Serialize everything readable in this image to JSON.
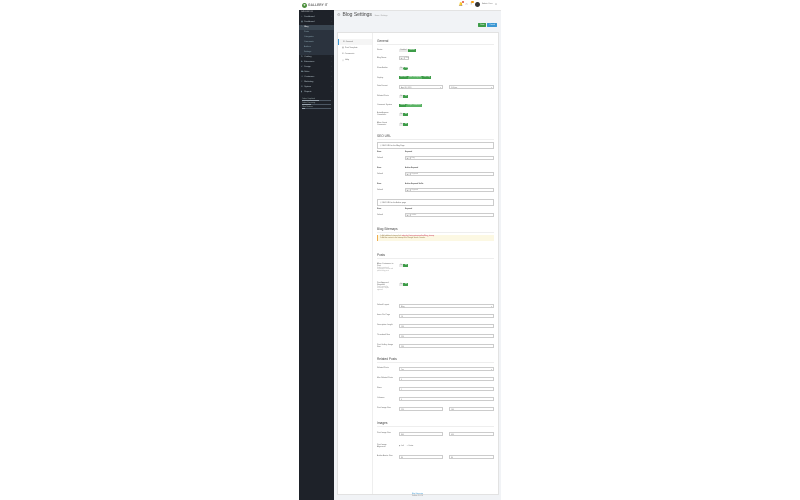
{
  "topbar": {
    "logo_text": "GALLERY IT",
    "badge_a": "1",
    "badge_b": "3",
    "user_name": "Admin User"
  },
  "sidebar": {
    "header": "NAVIGATION",
    "items": [
      {
        "label": "Dashboard",
        "icon": "home-icon"
      },
      {
        "label": "Dashboard",
        "icon": "grid-icon"
      },
      {
        "label": "Blog",
        "icon": "blog-icon",
        "active": true
      },
      {
        "label": "Catalog",
        "icon": "tag-icon"
      },
      {
        "label": "Extensions",
        "icon": "puzzle-icon"
      },
      {
        "label": "Design",
        "icon": "brush-icon"
      },
      {
        "label": "Sales",
        "icon": "cart-icon"
      },
      {
        "label": "Customers",
        "icon": "user-icon"
      },
      {
        "label": "Marketing",
        "icon": "share-icon"
      },
      {
        "label": "System",
        "icon": "gear-icon"
      },
      {
        "label": "Reports",
        "icon": "chart-icon"
      }
    ],
    "subitems": [
      "Posts",
      "Categories",
      "Comments",
      "Authors",
      "Settings"
    ],
    "stats": [
      {
        "label": "Orders Completed",
        "pct": 0.6
      },
      {
        "label": "Orders Processing",
        "pct": 0.3
      },
      {
        "label": "Other Statuses",
        "pct": 0.1
      }
    ]
  },
  "page": {
    "title": "Blog Settings",
    "breadcrumb": "Home / Settings",
    "actions": [
      "Save",
      "Cancel"
    ]
  },
  "tabs": [
    "General",
    "Post Template",
    "Comments",
    "Help"
  ],
  "general": {
    "section": "General",
    "status_label": "Status",
    "status_off": "Disabled",
    "status_on": "Enabled",
    "blog_name_label": "Blog Name",
    "blog_name_value": "Blog",
    "show_author_label": "Show Author",
    "show_author_off": "No",
    "show_author_on": "Yes",
    "display_label": "Display",
    "display_options": [
      "Full Post",
      "Short Description",
      "Title Only"
    ],
    "date_format_label": "Date Format",
    "date_format_value": "April 20, 2019",
    "time_format_value": "5:00 pm",
    "related_label": "Related Posts",
    "comment_label": "Comment System",
    "comment_options": [
      "Default",
      "Disqus Comments"
    ],
    "approve_label": "Auto-Approve Comments",
    "guest_label": "Allow Guest Comments",
    "toggle_no": "No",
    "toggle_yes": "Yes"
  },
  "seo": {
    "section": "SEO URL",
    "notice_1": "SEO URL for the Blog Page",
    "notice_2": "SEO URL for the Author page",
    "col_store": "Store",
    "col_keyword": "Keyword",
    "store_name": "Default",
    "kw_blog": "blog",
    "kw_author": "author",
    "kw_placeholder": "Keyword",
    "store_short": "Store",
    "col_author": "Author Keyword",
    "col_author2": "Author Keyword Suffix"
  },
  "sitemap": {
    "section": "Blog Sitemaps",
    "warn_1": "1. Add additional sitemap link:",
    "warn_link": "index.php?route=extension/feed/blog_sitemap",
    "warn_2": "2. Add the content to the sitemap file of Google Search Console."
  },
  "posts": {
    "section": "Posts",
    "f1": "Allow Customers to Post",
    "f1_sub": "Enable registered customers to create and publish blog posts",
    "f2": "Post Approval Required",
    "f2_sub": "Posts created by customers require approval",
    "f3": "Default Layout",
    "f3_value": "Blog",
    "f4": "Items Per Page",
    "f4_value": "10",
    "f5": "Description Length",
    "f5_value": "150",
    "f6": "Thumbnail Size",
    "f6_value": "220",
    "f7": "Post Gallery Image Size",
    "f7_value": "250"
  },
  "related": {
    "section": "Related Posts",
    "r1": "Related Posts",
    "r1_value": "Yes",
    "r2": "Max Related Posts",
    "r2_value": "4",
    "r3": "Rows",
    "r3_value": "1",
    "r4": "Columns",
    "r4_value": "4",
    "r5": "Post Image Size",
    "r5_w": "220",
    "r5_h": "140"
  },
  "images": {
    "section": "Images",
    "i1": "Post Image Size",
    "i1_w": "800",
    "i1_h": "450",
    "i2": "Post Image Alignment",
    "i2_opt1": "Left",
    "i2_opt2": "Center",
    "i3": "Author Avatar Size",
    "i3_w": "80",
    "i3_h": "80"
  },
  "footer": {
    "line1": "Blog Extension",
    "line2": "Version 3.0.2.0"
  }
}
